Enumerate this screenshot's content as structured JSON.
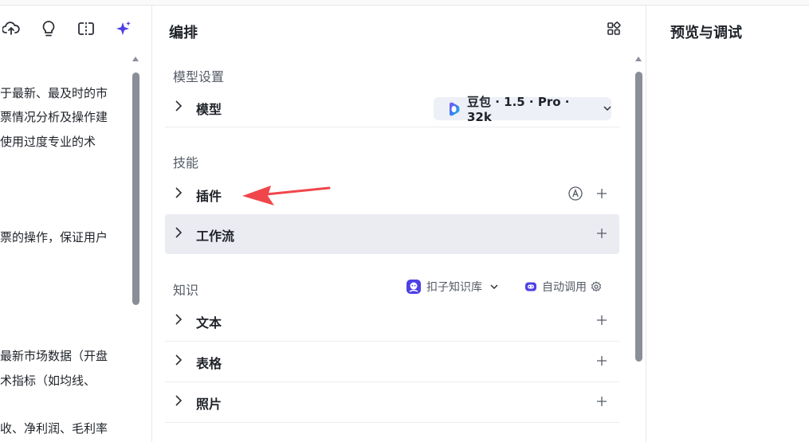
{
  "left_panel": {
    "toolbar_icons": [
      "cloud-upload-icon",
      "lightbulb-icon",
      "split-view-icon",
      "sparkle-icon"
    ],
    "text_lines": [
      "于最新、最及时的市",
      "票情况分析及操作建",
      "使用过度专业的术",
      "票的操作，保证用户",
      "最新市场数据（开盘",
      "术指标（如均线、",
      "收、净利润、毛利率"
    ]
  },
  "middle_panel": {
    "title": "编排",
    "model_section": {
      "title": "模型设置",
      "model_label": "模型",
      "model_value": "豆包 · 1.5 · Pro · 32k"
    },
    "skills_section": {
      "title": "技能",
      "items": [
        {
          "label": "插件"
        },
        {
          "label": "工作流"
        }
      ]
    },
    "knowledge_section": {
      "title": "知识",
      "kb_selector": "扣子知识库",
      "auto_call": "自动调用",
      "items": [
        {
          "label": "文本"
        },
        {
          "label": "表格"
        },
        {
          "label": "照片"
        }
      ]
    }
  },
  "right_panel": {
    "title": "预览与调试"
  },
  "colors": {
    "accent": "#4e40e5",
    "arrow": "#f0464b",
    "highlight_row": "#ebebf2"
  }
}
